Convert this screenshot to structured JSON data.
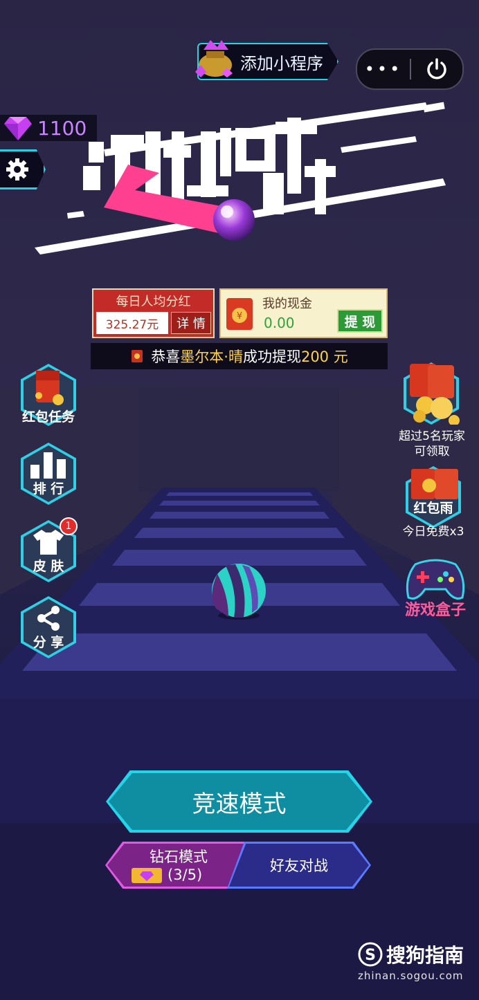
{
  "header": {
    "add_miniprogram_label": "添加小程序",
    "menu_dots": "•••"
  },
  "diamonds": {
    "count": "1100"
  },
  "logo": {
    "title_text": "冲刺吧球球"
  },
  "daily_dividend": {
    "title": "每日人均分红",
    "amount": "325.27元",
    "details_label": "详 情"
  },
  "cash": {
    "title": "我的现金",
    "value": "0.00",
    "withdraw_label": "提 现"
  },
  "ticker": {
    "prefix": "恭喜",
    "name": "墨尔本·晴",
    "middle": "成功提现",
    "amount": "200 元"
  },
  "left_menu": [
    {
      "label": "红包任务"
    },
    {
      "label": "排 行"
    },
    {
      "label": "皮 肤",
      "badge": "1"
    },
    {
      "label": "分 享"
    }
  ],
  "right_menu": [
    {
      "line1": "超过5名玩家",
      "line2": "可领取"
    },
    {
      "icon_label": "红包雨",
      "text": "今日免费x3"
    },
    {
      "icon_label": "游戏盒子"
    }
  ],
  "modes": {
    "race": "竞速模式",
    "diamond_mode": "钻石模式",
    "diamond_count": "(3/5)",
    "friend_battle": "好友对战"
  },
  "watermark": {
    "brand": "搜狗指南",
    "domain": "zhinan.sogou.com"
  },
  "colors": {
    "accent": "#2fd0e5",
    "diamond": "#c985ff",
    "gold": "#ffd447"
  }
}
